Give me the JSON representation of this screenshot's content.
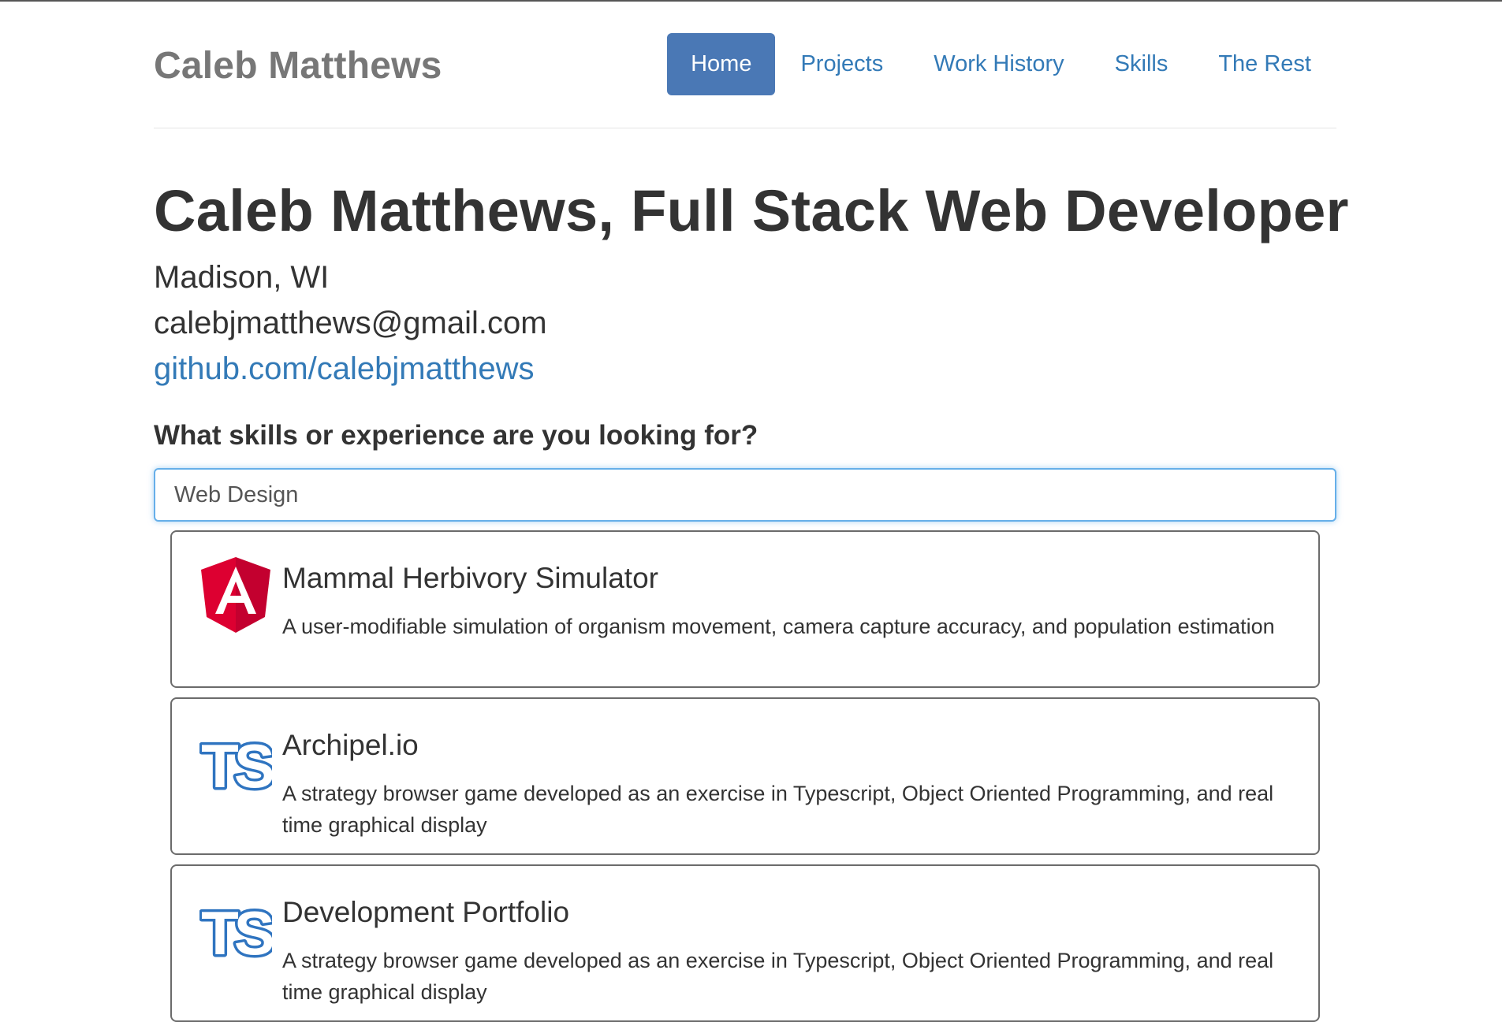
{
  "header": {
    "brand": "Caleb Matthews",
    "nav": [
      {
        "label": "Home",
        "active": true
      },
      {
        "label": "Projects",
        "active": false
      },
      {
        "label": "Work History",
        "active": false
      },
      {
        "label": "Skills",
        "active": false
      },
      {
        "label": "The Rest",
        "active": false
      }
    ]
  },
  "profile": {
    "title": "Caleb Matthews, Full Stack Web Developer",
    "location": "Madison, WI",
    "email": "calebjmatthews@gmail.com",
    "github": "github.com/calebjmatthews"
  },
  "search": {
    "question": "What skills or experience are you looking for?",
    "value": "Web Design"
  },
  "results": [
    {
      "icon": "angular-icon",
      "title": "Mammal Herbivory Simulator",
      "description": "A user-modifiable simulation of organism movement, camera capture accuracy, and population estimation"
    },
    {
      "icon": "typescript-icon",
      "title": "Archipel.io",
      "description": "A strategy browser game developed as an exercise in Typescript, Object Oriented Programming, and real time graphical display"
    },
    {
      "icon": "typescript-icon",
      "title": "Development Portfolio",
      "description": "A strategy browser game developed as an exercise in Typescript, Object Oriented Programming, and real time graphical display"
    }
  ],
  "colors": {
    "link": "#337ab7",
    "nav_active_bg": "#4a78b5",
    "angular_red": "#dd0031",
    "typescript_blue": "#2f74c0"
  }
}
